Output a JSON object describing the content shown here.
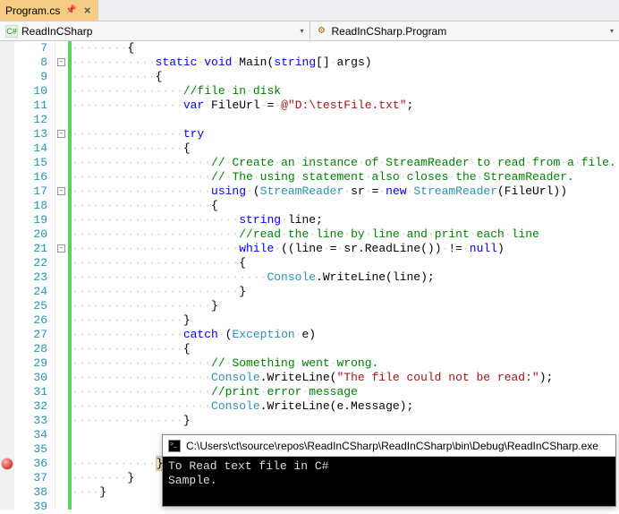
{
  "tab": {
    "filename": "Program.cs"
  },
  "nav": {
    "left_text": "ReadInCSharp",
    "right_text": "ReadInCSharp.Program"
  },
  "gutter": {
    "start": 7,
    "end": 39,
    "fold_lines": [
      8,
      13,
      17,
      21
    ],
    "breakpoint_line": 36
  },
  "code": {
    "lines": [
      {
        "n": 7,
        "indent": 8,
        "tokens": [
          {
            "t": "{",
            "c": "id"
          }
        ]
      },
      {
        "n": 8,
        "indent": 12,
        "tokens": [
          {
            "t": "static",
            "c": "kw"
          },
          {
            "t": " ",
            "c": "ws"
          },
          {
            "t": "void",
            "c": "kw"
          },
          {
            "t": " ",
            "c": "ws"
          },
          {
            "t": "Main",
            "c": "id"
          },
          {
            "t": "(",
            "c": "id"
          },
          {
            "t": "string",
            "c": "kw"
          },
          {
            "t": "[] args)",
            "c": "id"
          }
        ]
      },
      {
        "n": 9,
        "indent": 12,
        "tokens": [
          {
            "t": "{",
            "c": "id"
          }
        ]
      },
      {
        "n": 10,
        "indent": 16,
        "tokens": [
          {
            "t": "//file in disk",
            "c": "cm"
          }
        ]
      },
      {
        "n": 11,
        "indent": 16,
        "tokens": [
          {
            "t": "var",
            "c": "kw"
          },
          {
            "t": " FileUrl = ",
            "c": "id"
          },
          {
            "t": "@\"D:\\testFile.txt\"",
            "c": "str"
          },
          {
            "t": ";",
            "c": "id"
          }
        ]
      },
      {
        "n": 12,
        "indent": 0,
        "tokens": []
      },
      {
        "n": 13,
        "indent": 16,
        "tokens": [
          {
            "t": "try",
            "c": "kw"
          }
        ]
      },
      {
        "n": 14,
        "indent": 16,
        "tokens": [
          {
            "t": "{",
            "c": "id"
          }
        ]
      },
      {
        "n": 15,
        "indent": 20,
        "tokens": [
          {
            "t": "// Create an instance of StreamReader to read from a file.",
            "c": "cm"
          }
        ]
      },
      {
        "n": 16,
        "indent": 20,
        "tokens": [
          {
            "t": "// The using statement also closes the StreamReader.",
            "c": "cm"
          }
        ]
      },
      {
        "n": 17,
        "indent": 20,
        "tokens": [
          {
            "t": "using",
            "c": "kw"
          },
          {
            "t": " (",
            "c": "id"
          },
          {
            "t": "StreamReader",
            "c": "typ"
          },
          {
            "t": " sr = ",
            "c": "id"
          },
          {
            "t": "new",
            "c": "kw"
          },
          {
            "t": " ",
            "c": "ws"
          },
          {
            "t": "StreamReader",
            "c": "typ"
          },
          {
            "t": "(FileUrl))",
            "c": "id"
          }
        ]
      },
      {
        "n": 18,
        "indent": 20,
        "tokens": [
          {
            "t": "{",
            "c": "id"
          }
        ]
      },
      {
        "n": 19,
        "indent": 24,
        "tokens": [
          {
            "t": "string",
            "c": "kw"
          },
          {
            "t": " line;",
            "c": "id"
          }
        ]
      },
      {
        "n": 20,
        "indent": 24,
        "tokens": [
          {
            "t": "//read the line by line and print each line",
            "c": "cm"
          }
        ]
      },
      {
        "n": 21,
        "indent": 24,
        "tokens": [
          {
            "t": "while",
            "c": "kw"
          },
          {
            "t": " ((line = sr.ReadLine()) != ",
            "c": "id"
          },
          {
            "t": "null",
            "c": "kw"
          },
          {
            "t": ")",
            "c": "id"
          }
        ]
      },
      {
        "n": 22,
        "indent": 24,
        "tokens": [
          {
            "t": "{",
            "c": "id"
          }
        ]
      },
      {
        "n": 23,
        "indent": 28,
        "tokens": [
          {
            "t": "Console",
            "c": "typ"
          },
          {
            "t": ".WriteLine(line);",
            "c": "id"
          }
        ]
      },
      {
        "n": 24,
        "indent": 24,
        "tokens": [
          {
            "t": "}",
            "c": "id"
          }
        ]
      },
      {
        "n": 25,
        "indent": 20,
        "tokens": [
          {
            "t": "}",
            "c": "id"
          }
        ]
      },
      {
        "n": 26,
        "indent": 16,
        "tokens": [
          {
            "t": "}",
            "c": "id"
          }
        ]
      },
      {
        "n": 27,
        "indent": 16,
        "tokens": [
          {
            "t": "catch",
            "c": "kw"
          },
          {
            "t": " (",
            "c": "id"
          },
          {
            "t": "Exception",
            "c": "typ"
          },
          {
            "t": " e)",
            "c": "id"
          }
        ]
      },
      {
        "n": 28,
        "indent": 16,
        "tokens": [
          {
            "t": "{",
            "c": "id"
          }
        ]
      },
      {
        "n": 29,
        "indent": 20,
        "tokens": [
          {
            "t": "// Something went wrong.",
            "c": "cm"
          }
        ]
      },
      {
        "n": 30,
        "indent": 20,
        "tokens": [
          {
            "t": "Console",
            "c": "typ"
          },
          {
            "t": ".WriteLine(",
            "c": "id"
          },
          {
            "t": "\"The file could not be read:\"",
            "c": "str"
          },
          {
            "t": ");",
            "c": "id"
          }
        ]
      },
      {
        "n": 31,
        "indent": 20,
        "tokens": [
          {
            "t": "//print error message",
            "c": "cm"
          }
        ]
      },
      {
        "n": 32,
        "indent": 20,
        "tokens": [
          {
            "t": "Console",
            "c": "typ"
          },
          {
            "t": ".WriteLine(e.Message);",
            "c": "id"
          }
        ]
      },
      {
        "n": 33,
        "indent": 16,
        "tokens": [
          {
            "t": "}",
            "c": "id"
          }
        ]
      },
      {
        "n": 34,
        "indent": 0,
        "tokens": []
      },
      {
        "n": 35,
        "indent": 0,
        "tokens": []
      },
      {
        "n": 36,
        "indent": 12,
        "tokens": [
          {
            "t": "}",
            "c": "id",
            "cursor": true
          }
        ]
      },
      {
        "n": 37,
        "indent": 8,
        "tokens": [
          {
            "t": "}",
            "c": "id"
          }
        ]
      },
      {
        "n": 38,
        "indent": 4,
        "tokens": [
          {
            "t": "}",
            "c": "id"
          }
        ]
      },
      {
        "n": 39,
        "indent": 0,
        "tokens": []
      }
    ]
  },
  "console": {
    "title": "C:\\Users\\ct\\source\\repos\\ReadInCSharp\\ReadInCSharp\\bin\\Debug\\ReadInCSharp.exe",
    "lines": [
      "To Read text file in C#",
      "Sample."
    ]
  }
}
